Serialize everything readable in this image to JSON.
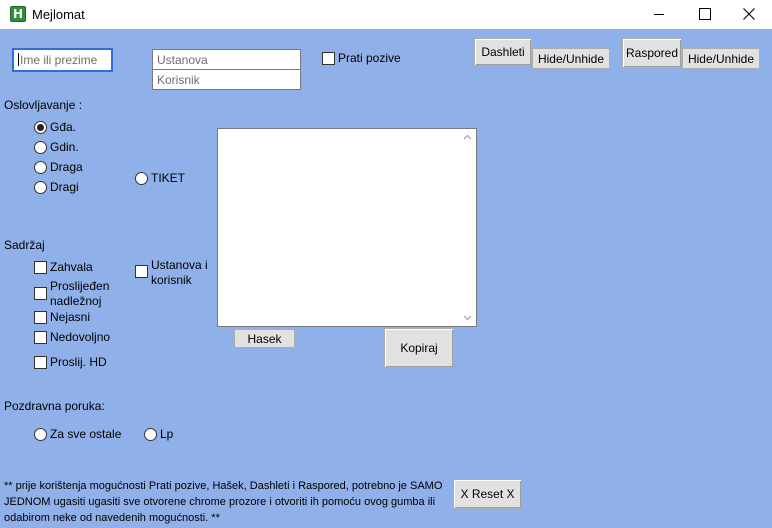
{
  "window": {
    "title": "Mejlomat",
    "app_icon_letter": "H"
  },
  "search": {
    "placeholder": "Ime ili prezime"
  },
  "ustanova_field": {
    "value": "Ustanova"
  },
  "korisnik_field": {
    "value": "Korisnik"
  },
  "prati_pozive": {
    "label": "Prati pozive",
    "checked": false
  },
  "top_buttons": {
    "dashleti": "Dashleti",
    "dashleti_toggle": "Hide/Unhide",
    "raspored": "Raspored",
    "raspored_toggle": "Hide/Unhide"
  },
  "oslovljavanje": {
    "heading": "Oslovljavanje :",
    "options": [
      "Gđa.",
      "Gdin.",
      "Draga",
      "Dragi"
    ],
    "selected": "Gđa.",
    "tiket": "TIKET"
  },
  "sadrzaj": {
    "heading": "Sadržaj",
    "items": [
      "Zahvala",
      "Proslijeđen nadležnoj",
      "Nejasni",
      "Nedovoljno",
      "Proslij. HD"
    ],
    "ustanova_i_korisnik": "Ustanova i korisnik"
  },
  "editor": {
    "content": ""
  },
  "buttons": {
    "hasek": "Hasek",
    "kopiraj": "Kopiraj",
    "reset": "X Reset X"
  },
  "pozdravna": {
    "heading": "Pozdravna poruka:",
    "options": [
      "Za sve ostale",
      "Lp"
    ]
  },
  "footer_note": "** prije korištenja mogućnosti Prati pozive, Hašek, Dashleti i Raspored, potrebno je SAMO JEDNOM ugasiti ugasiti sve otvorene chrome prozore i otvoriti ih pomoću ovog gumba ili odabirom neke od navedenih mogućnosti. **",
  "colors": {
    "background": "#8fb0e8",
    "titlebar": "#ffffff",
    "button_face": "#e1e1e1",
    "focus_border": "#2f6fd6"
  }
}
